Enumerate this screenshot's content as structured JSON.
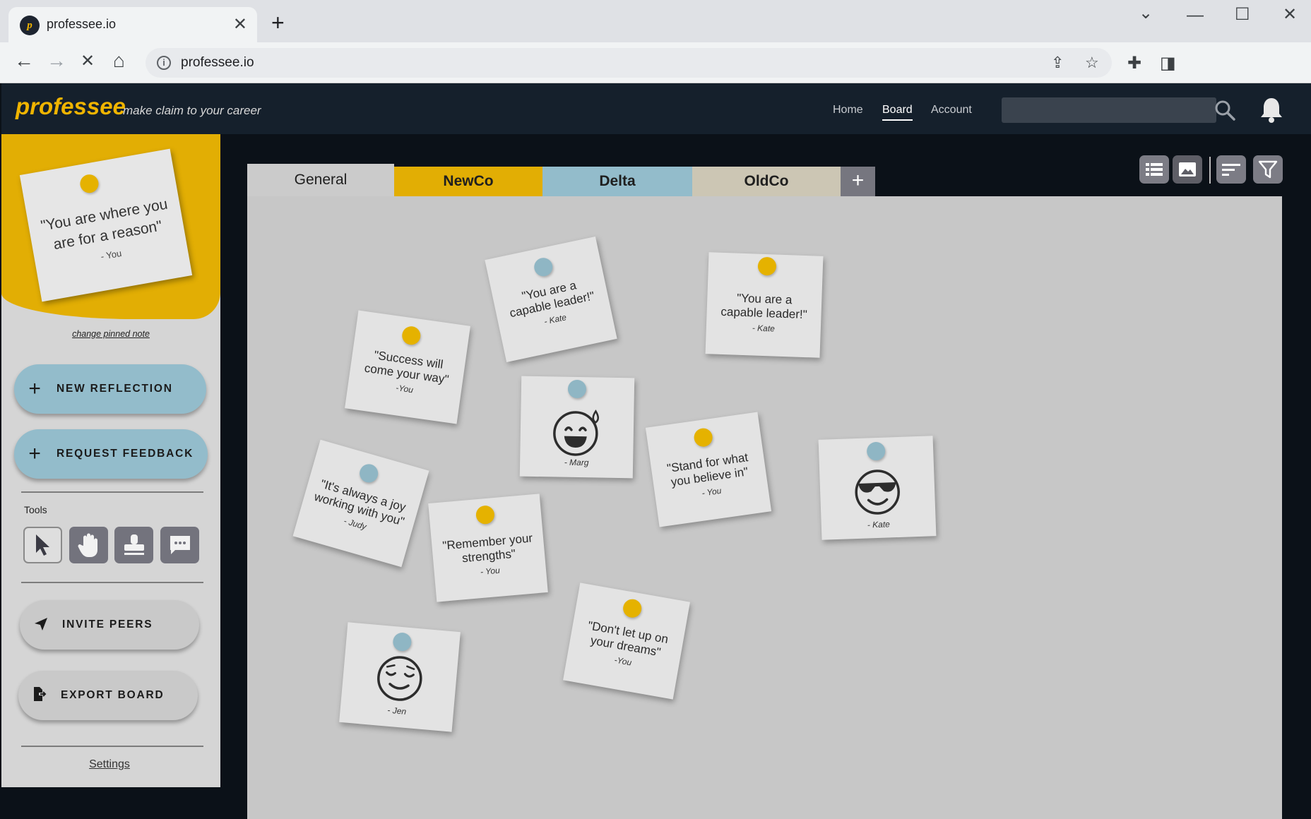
{
  "browser": {
    "tab_title": "professee.io",
    "favicon_letter": "p",
    "url": "professee.io"
  },
  "header": {
    "logo": "professee",
    "tagline": "make claim to your career",
    "nav": [
      {
        "label": "Home",
        "active": false
      },
      {
        "label": "Board",
        "active": true
      },
      {
        "label": "Account",
        "active": false
      }
    ],
    "search_placeholder": ""
  },
  "sidebar": {
    "pinned_note": {
      "quote": "\"You are where you are for a reason\"",
      "author": "- You",
      "pin_color": "yellow"
    },
    "change_pinned_label": "change pinned note",
    "new_reflection_label": "NEW REFLECTION",
    "request_feedback_label": "REQUEST FEEDBACK",
    "tools_label": "Tools",
    "tools": [
      {
        "name": "pointer",
        "selected": true
      },
      {
        "name": "hand",
        "selected": false
      },
      {
        "name": "stamp",
        "selected": false
      },
      {
        "name": "comment",
        "selected": false
      }
    ],
    "invite_peers_label": "INVITE PEERS",
    "export_board_label": "EXPORT BOARD",
    "settings_label": "Settings"
  },
  "board": {
    "tabs": [
      {
        "label": "General",
        "color": "#cbcbcb",
        "active": true
      },
      {
        "label": "NewCo",
        "color": "#e2ae04",
        "active": false
      },
      {
        "label": "Delta",
        "color": "#93bccb",
        "active": false
      },
      {
        "label": "OldCo",
        "color": "#ccc6b4",
        "active": false
      }
    ],
    "add_tab_label": "+",
    "view_controls": [
      "list-view-icon",
      "image-view-icon",
      "sort-icon",
      "filter-icon"
    ],
    "notes": [
      {
        "quote": "\"You are a capable leader!\"",
        "author": "- Kate",
        "pin": "blue"
      },
      {
        "quote": "\"You are a capable leader!\"",
        "author": "- Kate",
        "pin": "yellow"
      },
      {
        "quote": "\"Success will come your way\"",
        "author": "-You",
        "pin": "yellow"
      },
      {
        "emoji": "grinning-sweat",
        "author": "- Marg",
        "pin": "blue"
      },
      {
        "quote": "\"Stand for what you believe in\"",
        "author": "- You",
        "pin": "yellow"
      },
      {
        "emoji": "sunglasses",
        "author": "- Kate",
        "pin": "blue"
      },
      {
        "quote": "\"It's always a joy working with you\"",
        "author": "- Judy",
        "pin": "blue"
      },
      {
        "quote": "\"Remember your strengths\"",
        "author": "- You",
        "pin": "yellow"
      },
      {
        "quote": "\"Don't let up on your dreams\"",
        "author": "-You",
        "pin": "yellow"
      },
      {
        "emoji": "relieved",
        "author": "- Jen",
        "pin": "blue"
      }
    ]
  },
  "colors": {
    "brand_yellow": "#e2ae04",
    "accent_blue": "#93bccb",
    "header_bg": "#15202c"
  }
}
